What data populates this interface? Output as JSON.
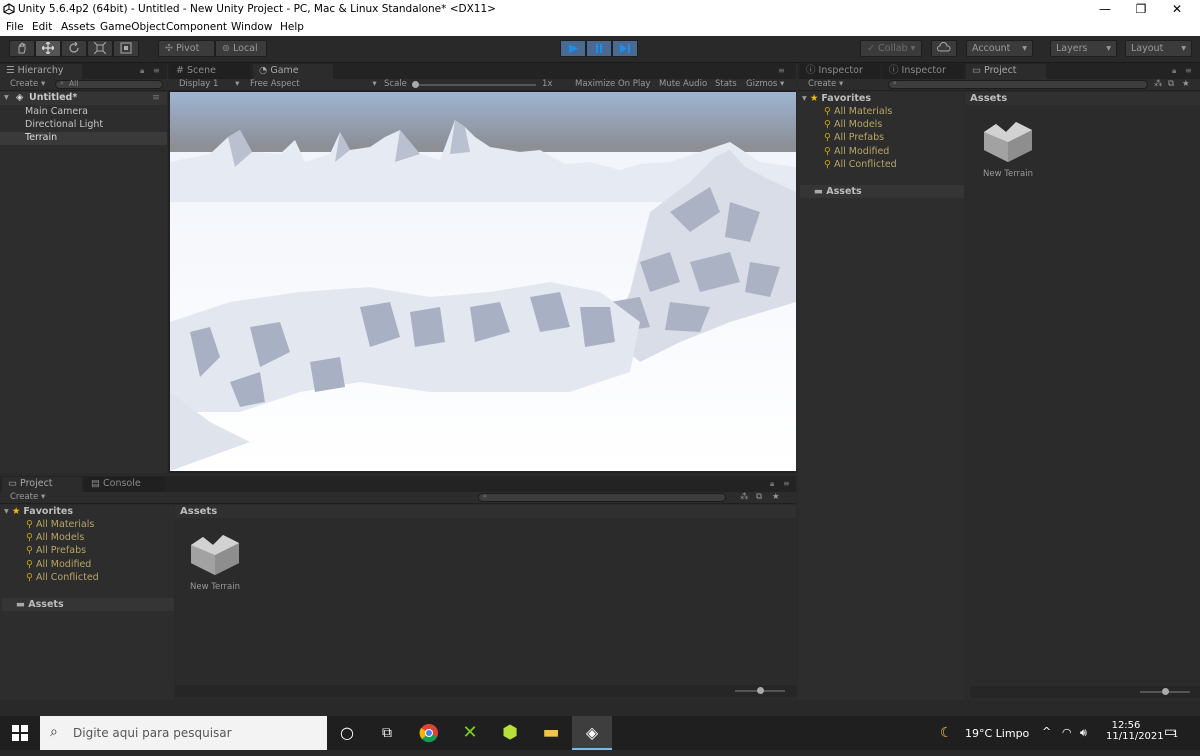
{
  "window": {
    "title": "Unity 5.6.4p2 (64bit) - Untitled - New Unity Project - PC, Mac & Linux Standalone* <DX11>"
  },
  "menu": [
    "File",
    "Edit",
    "Assets",
    "GameObject",
    "Component",
    "Window",
    "Help"
  ],
  "toolbar": {
    "pivot": "Pivot",
    "local": "Local",
    "collab": "Collab",
    "account": "Account",
    "layers": "Layers",
    "layout": "Layout"
  },
  "hierarchy": {
    "tab": "Hierarchy",
    "create": "Create",
    "search": "All",
    "scene": "Untitled*",
    "items": [
      "Main Camera",
      "Directional Light",
      "Terrain"
    ]
  },
  "gameview": {
    "tab_scene": "Scene",
    "tab_game": "Game",
    "display": "Display 1",
    "aspect": "Free Aspect",
    "scale_label": "Scale",
    "scale_value": "1x",
    "maximize": "Maximize On Play",
    "mute": "Mute Audio",
    "stats": "Stats",
    "gizmos": "Gizmos"
  },
  "project_bottom": {
    "tab_project": "Project",
    "tab_console": "Console",
    "create": "Create",
    "favorites": "Favorites",
    "fav_items": [
      "All Materials",
      "All Models",
      "All Prefabs",
      "All Modified",
      "All Conflicted"
    ],
    "assets_folder": "Assets",
    "assets_header": "Assets",
    "asset_name": "New Terrain"
  },
  "right": {
    "tab_inspector1": "Inspector",
    "tab_inspector2": "Inspector",
    "tab_project": "Project",
    "create": "Create",
    "favorites": "Favorites",
    "fav_items": [
      "All Materials",
      "All Models",
      "All Prefabs",
      "All Modified",
      "All Conflicted"
    ],
    "assets_folder": "Assets",
    "assets_header": "Assets",
    "asset_name": "New Terrain"
  },
  "taskbar": {
    "search_placeholder": "Digite aqui para pesquisar",
    "weather": "19°C  Limpo",
    "time": "12:56",
    "date": "11/11/2021",
    "notification_count": "1"
  },
  "colors": {
    "accent_play": "#4a6a92",
    "favorite_icon": "#c8a418"
  }
}
